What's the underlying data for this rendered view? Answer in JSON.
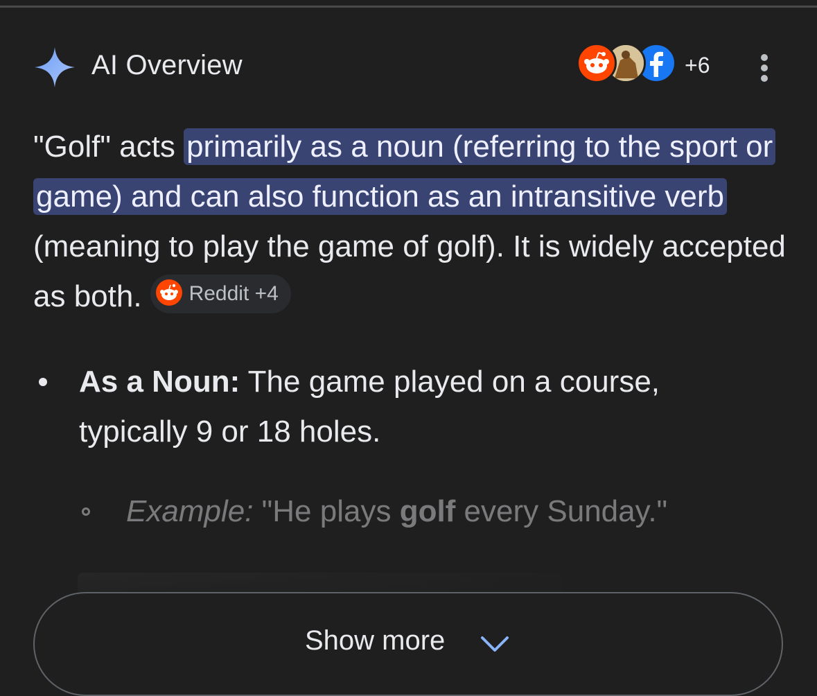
{
  "header": {
    "title": "AI Overview",
    "sources_more": "+6",
    "source_icons": [
      "reddit-icon",
      "photo-source-icon",
      "facebook-icon"
    ]
  },
  "summary": {
    "prefix": "\"Golf\" acts ",
    "highlight": "primarily as a noun (referring to the sport or game) and can also function as an intransitive verb",
    "suffix": " (meaning to play the game of golf). It is widely accepted as both.",
    "citation_chip": "Reddit +4"
  },
  "bullets": [
    {
      "label": "As a Noun:",
      "text": " The game played on a course, typically 9 or 18 holes."
    }
  ],
  "example": {
    "label": "Example:",
    "pre": " \"He plays ",
    "bold": "golf",
    "post": " every Sunday.\""
  },
  "show_more": {
    "label": "Show more"
  },
  "colors": {
    "background": "#1f1f1f",
    "highlight": "#394472",
    "reddit": "#ff4500",
    "facebook": "#1877f2",
    "spark": "#8ab4f8"
  }
}
